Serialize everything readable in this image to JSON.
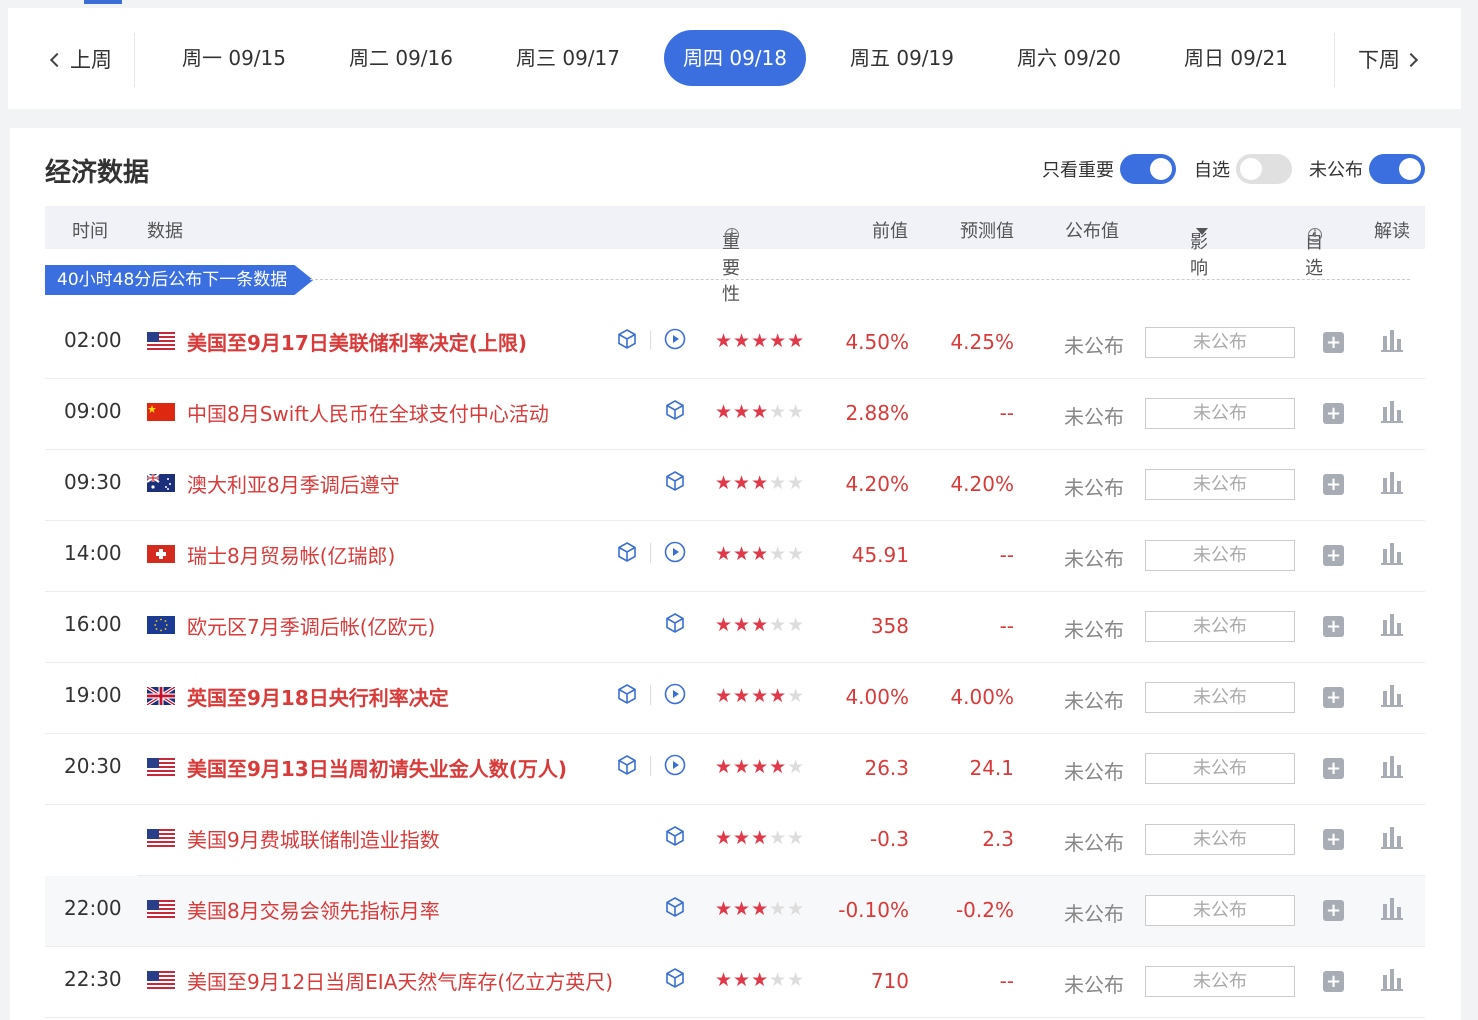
{
  "week_nav": {
    "prev_label": "上周",
    "next_label": "下周",
    "days": [
      {
        "label": "周一 09/15"
      },
      {
        "label": "周二 09/16"
      },
      {
        "label": "周三 09/17"
      },
      {
        "label": "周四 09/18",
        "active": true
      },
      {
        "label": "周五 09/19"
      },
      {
        "label": "周六 09/20"
      },
      {
        "label": "周日 09/21"
      }
    ]
  },
  "panel": {
    "title": "经济数据",
    "toggles": {
      "important_only": {
        "label": "只看重要",
        "on": true
      },
      "watchlist": {
        "label": "自选",
        "on": false
      },
      "unpublished": {
        "label": "未公布",
        "on": true
      }
    },
    "columns": {
      "time": "时间",
      "data": "数据",
      "importance": "重要性",
      "previous": "前值",
      "forecast": "预测值",
      "actual": "公布值",
      "impact": "影响",
      "watch": "自选",
      "analysis": "解读"
    },
    "countdown_banner": "40小时48分后公布下一条数据"
  },
  "events": [
    {
      "time": "02:00",
      "flag": "us",
      "name": "美国至9月17日美联储利率决定(上限)",
      "bold": true,
      "video": true,
      "stars": 5,
      "previous": "4.50%",
      "forecast": "4.25%",
      "status": "未公布",
      "actual_placeholder": "未公布"
    },
    {
      "time": "09:00",
      "flag": "cn",
      "name": "中国8月Swift人民币在全球支付中心活动",
      "bold": false,
      "video": false,
      "stars": 3,
      "previous": "2.88%",
      "forecast": "--",
      "status": "未公布",
      "actual_placeholder": "未公布"
    },
    {
      "time": "09:30",
      "flag": "au",
      "name": "澳大利亚8月季调后遵守",
      "bold": false,
      "video": false,
      "stars": 3,
      "previous": "4.20%",
      "forecast": "4.20%",
      "status": "未公布",
      "actual_placeholder": "未公布"
    },
    {
      "time": "14:00",
      "flag": "ch",
      "name": "瑞士8月贸易帐(亿瑞郎)",
      "bold": false,
      "video": true,
      "stars": 3,
      "previous": "45.91",
      "forecast": "--",
      "status": "未公布",
      "actual_placeholder": "未公布"
    },
    {
      "time": "16:00",
      "flag": "eu",
      "name": "欧元区7月季调后帐(亿欧元)",
      "bold": false,
      "video": false,
      "stars": 3,
      "previous": "358",
      "forecast": "--",
      "status": "未公布",
      "actual_placeholder": "未公布"
    },
    {
      "time": "19:00",
      "flag": "uk",
      "name": "英国至9月18日央行利率决定",
      "bold": true,
      "video": true,
      "stars": 4,
      "previous": "4.00%",
      "forecast": "4.00%",
      "status": "未公布",
      "actual_placeholder": "未公布"
    },
    {
      "time": "20:30",
      "flag": "us",
      "name": "美国至9月13日当周初请失业金人数(万人)",
      "bold": true,
      "video": true,
      "stars": 4,
      "previous": "26.3",
      "forecast": "24.1",
      "status": "未公布",
      "actual_placeholder": "未公布"
    },
    {
      "time": "",
      "flag": "us",
      "name": "美国9月费城联储制造业指数",
      "bold": false,
      "video": false,
      "stars": 3,
      "previous": "-0.3",
      "forecast": "2.3",
      "status": "未公布",
      "actual_placeholder": "未公布",
      "sub": true
    },
    {
      "time": "22:00",
      "flag": "us",
      "name": "美国8月交易会领先指标月率",
      "bold": false,
      "video": false,
      "stars": 3,
      "previous": "-0.10%",
      "forecast": "-0.2%",
      "status": "未公布",
      "actual_placeholder": "未公布",
      "shaded": true
    },
    {
      "time": "22:30",
      "flag": "us",
      "name": "美国至9月12日当周EIA天然气库存(亿立方英尺)",
      "bold": false,
      "video": false,
      "stars": 3,
      "previous": "710",
      "forecast": "--",
      "status": "未公布",
      "actual_placeholder": "未公布"
    }
  ],
  "colors": {
    "accent": "#3b6fe0",
    "event_red": "#d93a3a",
    "star_red": "#e0394a"
  },
  "icons": {
    "cube": "data-cube-icon",
    "play": "play-video-icon",
    "plus": "plus-icon",
    "chart": "bar-chart-icon",
    "info": "info-icon"
  }
}
